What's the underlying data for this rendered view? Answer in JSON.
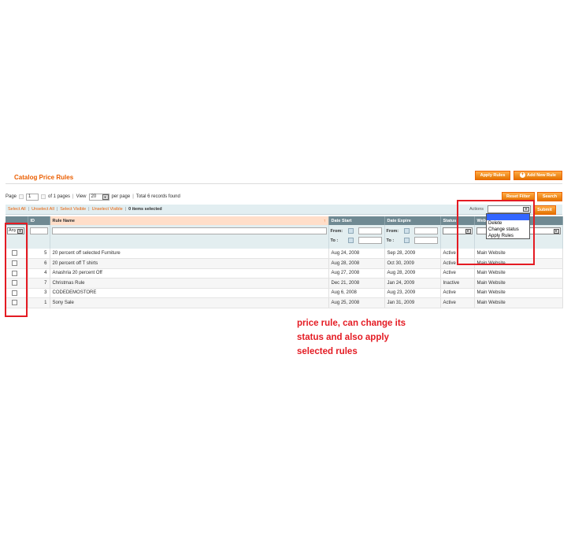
{
  "header": {
    "title": "Catalog Price Rules",
    "apply_rules_label": "Apply Rules",
    "add_new_rule_label": "Add New Rule"
  },
  "pager": {
    "page_label": "Page",
    "page_value": "1",
    "of_pages": "of 1 pages",
    "view_label": "View",
    "per_page_value": "20",
    "per_page_label": "per page",
    "total": "Total 6 records found",
    "reset_filter_label": "Reset Filter",
    "search_label": "Search"
  },
  "massaction": {
    "select_all": "Select All",
    "unselect_all": "Unselect All",
    "select_visible": "Select Visible",
    "unselect_visible": "Unselect Visible",
    "selected_count": "0 items selected",
    "actions_label": "Actions",
    "submit_label": "Submit",
    "options": [
      "",
      "Delete",
      "Change status",
      "Apply Rules"
    ]
  },
  "grid": {
    "columns": [
      "",
      "ID",
      "Rule Name",
      "Date Start",
      "Date Expire",
      "Status",
      "Website"
    ],
    "status_header_visible": "Status",
    "website_header_visible": "Web",
    "filter": {
      "any": "Any",
      "from": "From:",
      "to": "To :"
    },
    "rows": [
      {
        "id": "5",
        "name": "20 percent off selected Furniture",
        "start": "Aug 24, 2008",
        "expire": "Sep 28, 2009",
        "status": "Active",
        "website": "Main Website"
      },
      {
        "id": "6",
        "name": "20 percent off T shirts",
        "start": "Aug 28, 2008",
        "expire": "Oct 30, 2009",
        "status": "Active",
        "website": "Main Website"
      },
      {
        "id": "4",
        "name": "Anashria 20 percent Off",
        "start": "Aug 27, 2008",
        "expire": "Aug 28, 2009",
        "status": "Active",
        "website": "Main Website"
      },
      {
        "id": "7",
        "name": "Christmas Rule",
        "start": "Dec 21, 2008",
        "expire": "Jan 24, 2009",
        "status": "Inactive",
        "website": "Main Website"
      },
      {
        "id": "3",
        "name": "CODEDEMOSTORE",
        "start": "Aug 6, 2008",
        "expire": "Aug 23, 2009",
        "status": "Active",
        "website": "Main Website"
      },
      {
        "id": "1",
        "name": "Sony Sale",
        "start": "Aug 25, 2008",
        "expire": "Jan 31, 2009",
        "status": "Active",
        "website": "Main Website"
      }
    ]
  },
  "annotation": {
    "line1": "price rule, can change its",
    "line2": "status and also apply",
    "line3": "selected rules"
  },
  "colors": {
    "accent": "#eb5e00",
    "header_bg": "#6f8992",
    "annotation_red": "#e41b23"
  }
}
